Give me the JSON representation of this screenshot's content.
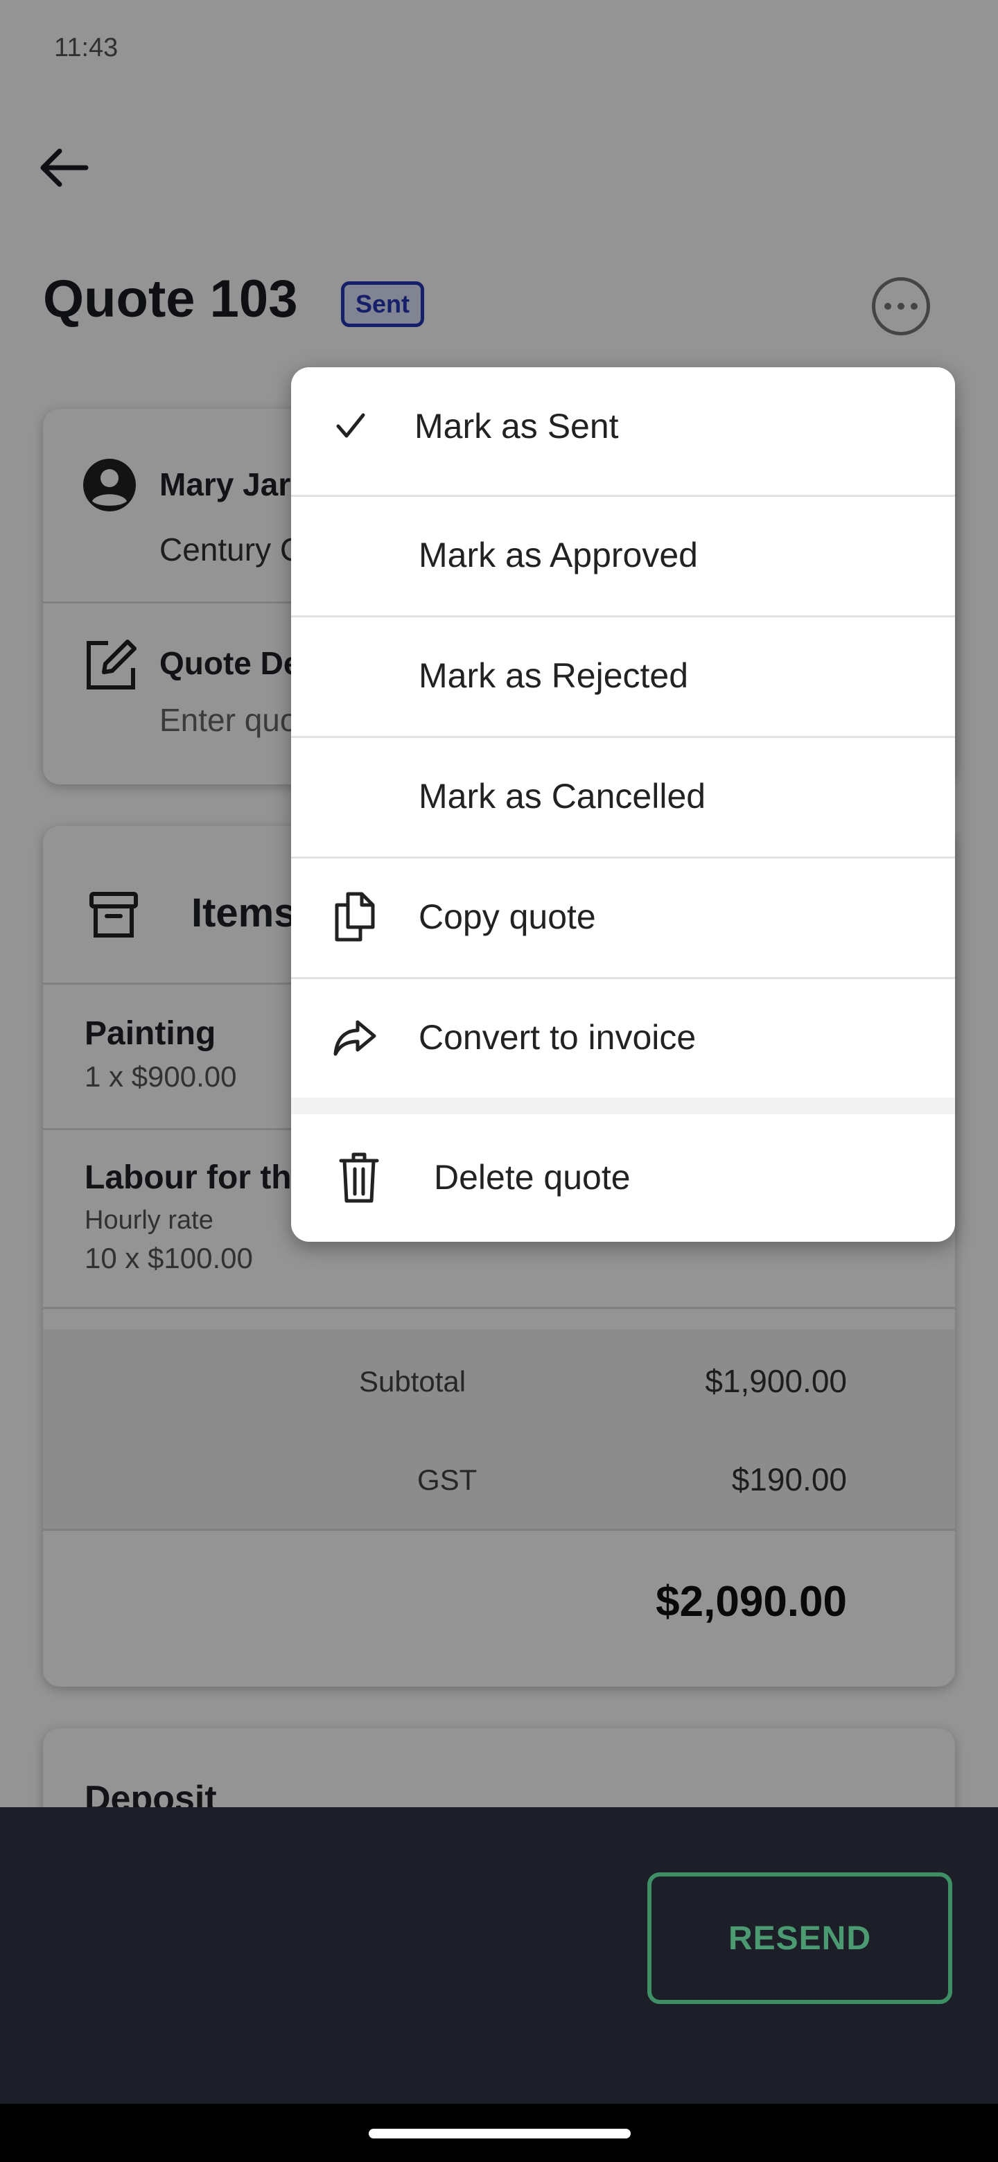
{
  "status_bar": {
    "time": "11:43"
  },
  "header": {
    "title": "Quote 103",
    "status_badge": "Sent"
  },
  "client": {
    "name": "Mary Jar",
    "company": "Century C"
  },
  "quote_details": {
    "label": "Quote De",
    "placeholder": "Enter quo"
  },
  "items_section": {
    "title": "Items",
    "items": [
      {
        "name": "Painting",
        "detail": "1 x $900.00"
      },
      {
        "name": "Labour for th",
        "subtitle": "Hourly rate",
        "detail": "10 x $100.00"
      }
    ]
  },
  "totals": {
    "subtotal_label": "Subtotal",
    "subtotal_value": "$1,900.00",
    "gst_label": "GST",
    "gst_value": "$190.00",
    "total_value": "$2,090.00"
  },
  "deposit_section": {
    "title": "Deposit"
  },
  "actions": {
    "resend_label": "RESEND"
  },
  "menu": {
    "items": [
      {
        "label": "Mark as Sent",
        "checked": true
      },
      {
        "label": "Mark as Approved"
      },
      {
        "label": "Mark as Rejected"
      },
      {
        "label": "Mark as Cancelled"
      },
      {
        "label": "Copy quote",
        "icon": "copy-icon"
      },
      {
        "label": "Convert to invoice",
        "icon": "share-arrow-icon"
      },
      {
        "label": "Delete quote",
        "icon": "trash-icon"
      }
    ]
  },
  "colors": {
    "badge": "#2636b5",
    "accent_green": "#4c9a72",
    "bottom_bar": "#1c1f27"
  }
}
